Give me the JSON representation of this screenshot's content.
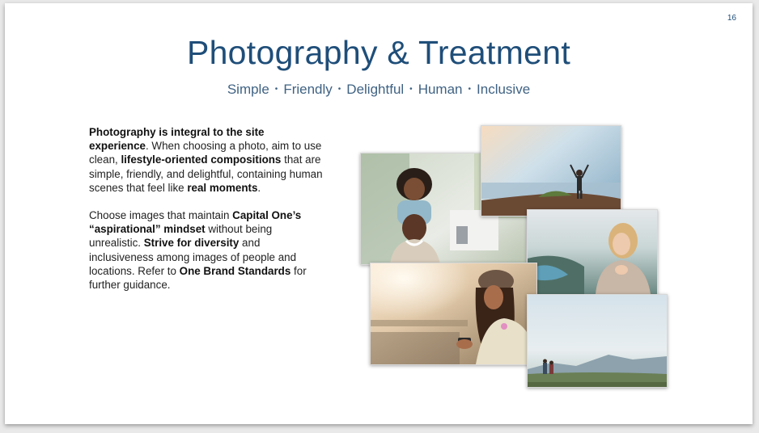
{
  "slide": {
    "page_number": "16",
    "title": "Photography & Treatment",
    "subtitle_items": [
      "Simple",
      "Friendly",
      "Delightful",
      "Human",
      "Inclusive"
    ],
    "separator": "•",
    "paragraph1": {
      "b1": "Photography is integral to the site experience",
      "t1": ". When choosing a photo, aim to use clean, ",
      "b2": "lifestyle-oriented compositions",
      "t2": " that are simple, friendly, and delightful, containing human scenes that feel like ",
      "b3": "real moments",
      "t3": "."
    },
    "paragraph2": {
      "t1": "Choose images that maintain ",
      "b1": "Capital One’s “aspirational” mindset",
      "t2": " without being unrealistic. ",
      "b2": "Strive for diversity",
      "t3": " and inclusiveness among images of people and locations. Refer to ",
      "b3": "One Brand Standards",
      "t4": " for further guidance."
    }
  }
}
